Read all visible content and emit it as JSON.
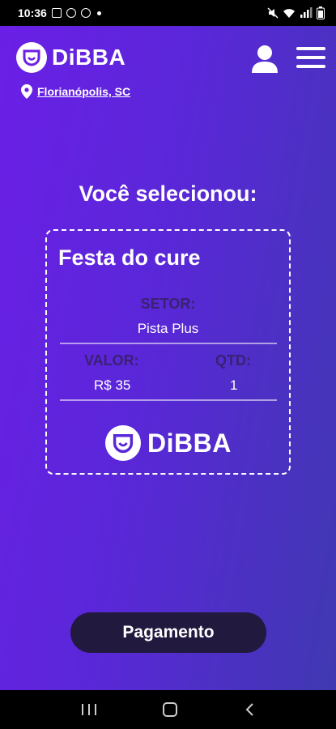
{
  "status_bar": {
    "time": "10:36"
  },
  "brand": {
    "name": "DiBBA"
  },
  "header": {
    "location": "Florianópolis, SC"
  },
  "main": {
    "heading": "Você selecionou:",
    "ticket": {
      "event_name": "Festa do cure",
      "setor_label": "SETOR:",
      "setor_value": "Pista Plus",
      "valor_label": "VALOR:",
      "valor_value": "R$ 35",
      "qtd_label": "QTD:",
      "qtd_value": "1"
    },
    "payment_button": "Pagamento"
  },
  "colors": {
    "gradient_start": "#6b1fe6",
    "gradient_end": "#3f39b0",
    "label_color": "#3a2173",
    "button_bg": "#22193f"
  },
  "icons": [
    "gallery-icon",
    "whatsapp-icon",
    "at-icon",
    "mute-icon",
    "wifi-icon",
    "signal-icon",
    "battery-icon",
    "user-icon",
    "menu-icon",
    "location-pin-icon"
  ]
}
